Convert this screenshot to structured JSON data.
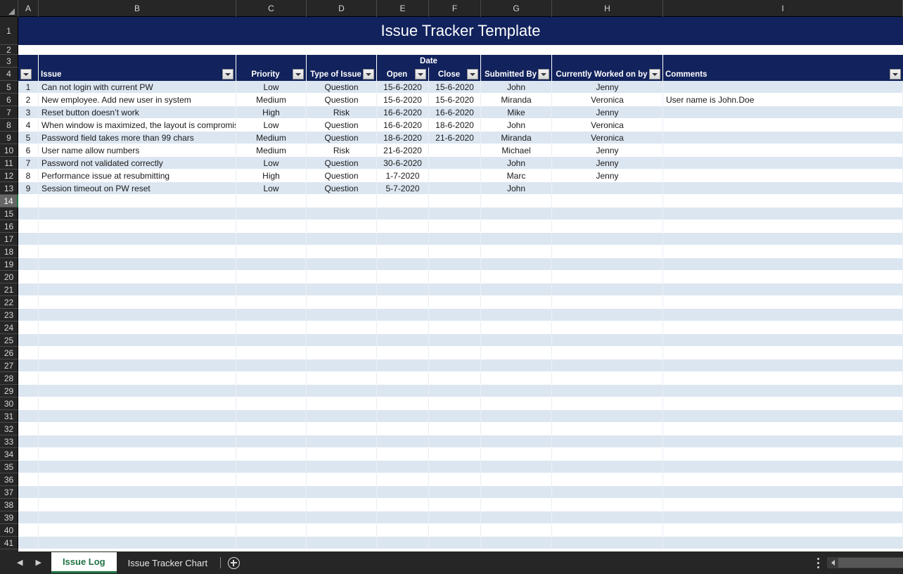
{
  "app": {
    "type": "spreadsheet",
    "theme": "dark-chrome",
    "accent_color": "#11225c",
    "band_color": "#dce6f1",
    "active_tab_color": "#1f7244"
  },
  "column_headers": [
    "A",
    "B",
    "C",
    "D",
    "E",
    "F",
    "G",
    "H",
    "I"
  ],
  "row_headers": [
    "1",
    "2",
    "3",
    "4",
    "5",
    "6",
    "7",
    "8",
    "9",
    "10",
    "11",
    "12",
    "13",
    "14",
    "15",
    "16",
    "17",
    "18",
    "19",
    "20",
    "21",
    "22",
    "23",
    "24",
    "25",
    "26",
    "27",
    "28",
    "29",
    "30",
    "31",
    "32",
    "33",
    "34",
    "35",
    "36",
    "37",
    "38",
    "39",
    "40",
    "41"
  ],
  "selected_row": "14",
  "title": {
    "text": "Issue Tracker Template"
  },
  "group_header": {
    "date_label": "Date"
  },
  "table": {
    "headers": {
      "rownum": "",
      "issue": "Issue",
      "priority": "Priority",
      "type_of_issue": "Type of Issue",
      "open": "Open",
      "close": "Close",
      "submitted_by": "Submitted By",
      "currently_worked_on_by": "Currently Worked on by",
      "comments": "Comments"
    },
    "rows": [
      {
        "num": "1",
        "issue": "Can not login with current PW",
        "priority": "Low",
        "type": "Question",
        "open": "15-6-2020",
        "close": "15-6-2020",
        "submitted_by": "John",
        "worked_on_by": "Jenny",
        "comments": ""
      },
      {
        "num": "2",
        "issue": "New employee. Add new user in system",
        "priority": "Medium",
        "type": "Question",
        "open": "15-6-2020",
        "close": "15-6-2020",
        "submitted_by": "Miranda",
        "worked_on_by": "Veronica",
        "comments": "User name is John.Doe"
      },
      {
        "num": "3",
        "issue": "Reset button doesn’t work",
        "priority": "High",
        "type": "Risk",
        "open": "16-6-2020",
        "close": "16-6-2020",
        "submitted_by": "Mike",
        "worked_on_by": "Jenny",
        "comments": ""
      },
      {
        "num": "4",
        "issue": "When window is maximized, the layout is compromised",
        "priority": "Low",
        "type": "Question",
        "open": "16-6-2020",
        "close": "18-6-2020",
        "submitted_by": "John",
        "worked_on_by": "Veronica",
        "comments": ""
      },
      {
        "num": "5",
        "issue": "Password field takes more than 99 chars",
        "priority": "Medium",
        "type": "Question",
        "open": "18-6-2020",
        "close": "21-6-2020",
        "submitted_by": "Miranda",
        "worked_on_by": "Veronica",
        "comments": ""
      },
      {
        "num": "6",
        "issue": "User name allow numbers",
        "priority": "Medium",
        "type": "Risk",
        "open": "21-6-2020",
        "close": "",
        "submitted_by": "Michael",
        "worked_on_by": "Jenny",
        "comments": ""
      },
      {
        "num": "7",
        "issue": "Password not validated correctly",
        "priority": "Low",
        "type": "Question",
        "open": "30-6-2020",
        "close": "",
        "submitted_by": "John",
        "worked_on_by": "Jenny",
        "comments": ""
      },
      {
        "num": "8",
        "issue": "Performance issue at resubmitting",
        "priority": "High",
        "type": "Question",
        "open": "1-7-2020",
        "close": "",
        "submitted_by": "Marc",
        "worked_on_by": "Jenny",
        "comments": ""
      },
      {
        "num": "9",
        "issue": "Session timeout on PW reset",
        "priority": "Low",
        "type": "Question",
        "open": "5-7-2020",
        "close": "",
        "submitted_by": "John",
        "worked_on_by": "",
        "comments": ""
      }
    ]
  },
  "sheet_tabs": {
    "prev_label": "◀",
    "next_label": "▶",
    "tabs": [
      {
        "label": "Issue Log",
        "active": true
      },
      {
        "label": "Issue Tracker Chart",
        "active": false
      }
    ],
    "add_sheet_icon": "plus-circle-icon"
  },
  "icons": {
    "filter": "filter-dropdown-icon",
    "select_all": "select-all-corner-icon",
    "kebab": "more-options-icon",
    "scroll_left": "scroll-left-icon"
  }
}
